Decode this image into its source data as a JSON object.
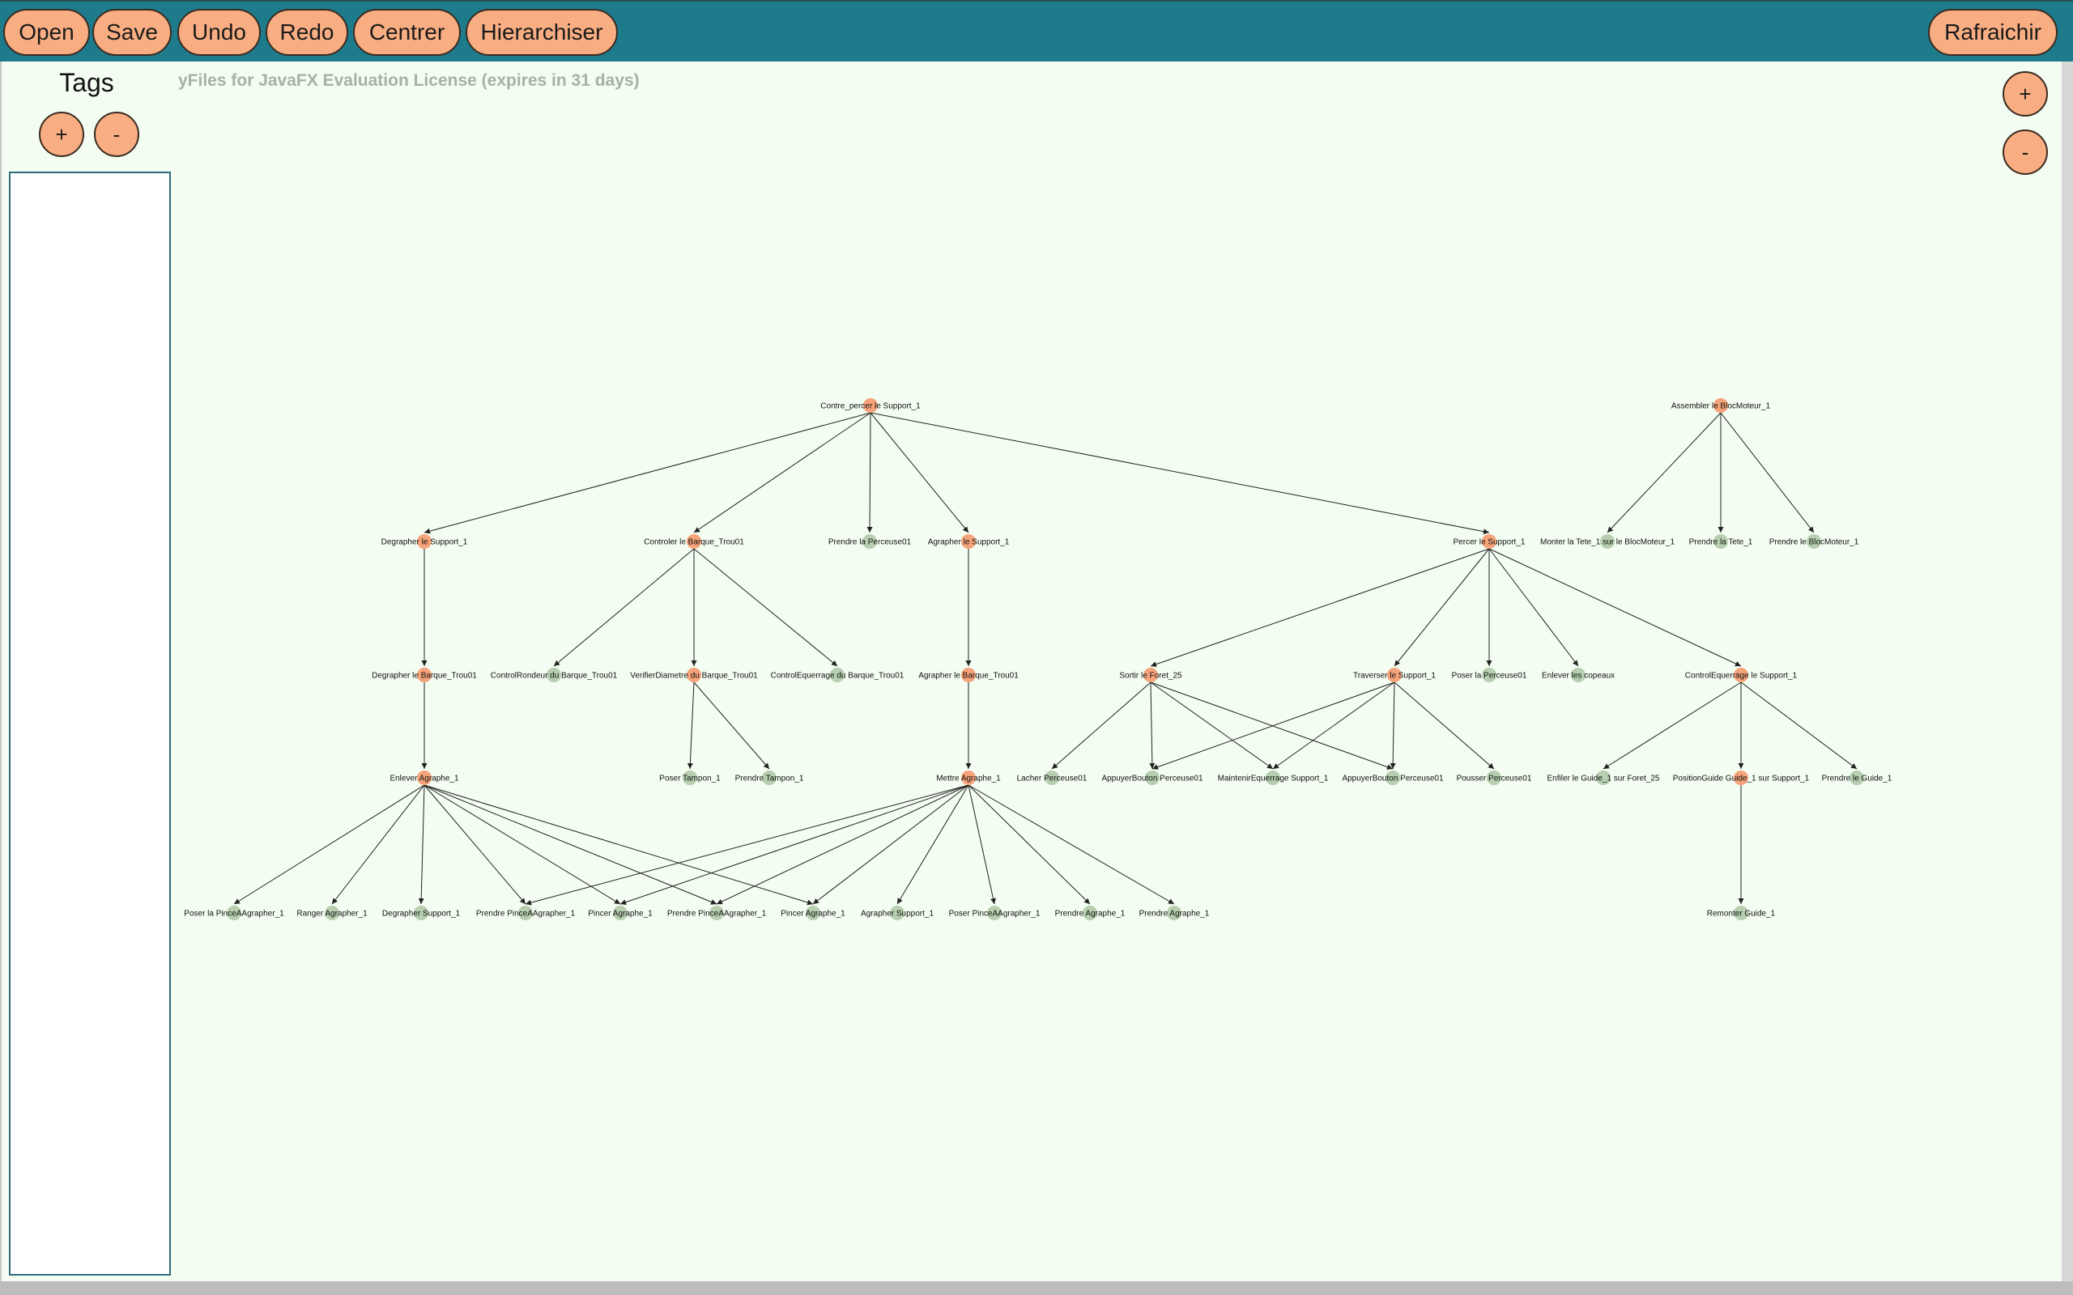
{
  "toolbar": {
    "open": "Open",
    "save": "Save",
    "undo": "Undo",
    "redo": "Redo",
    "centrer": "Centrer",
    "hierarchiser": "Hierarchiser",
    "rafraichir": "Rafraichir"
  },
  "tags": {
    "title": "Tags",
    "add": "+",
    "remove": "-"
  },
  "zoom": {
    "in": "+",
    "out": "-"
  },
  "license": "yFiles for JavaFX Evaluation License (expires in 31 days)",
  "colors": {
    "toolbar": "#1e7b8b",
    "button": "#f8ae82",
    "canvas": "#f3fdf1",
    "node_composite": "#f5a37a",
    "node_leaf": "#b7cfb0"
  },
  "graph": {
    "nodes": [
      {
        "id": "n1",
        "label": "Contre_percer le Support_1",
        "kind": "composite"
      },
      {
        "id": "n2",
        "label": "Assembler le BlocMoteur_1",
        "kind": "composite"
      },
      {
        "id": "n3",
        "label": "Degrapher le Support_1",
        "kind": "composite"
      },
      {
        "id": "n4",
        "label": "Controler le Barque_Trou01",
        "kind": "composite"
      },
      {
        "id": "n5",
        "label": "Prendre la Perceuse01",
        "kind": "leaf"
      },
      {
        "id": "n6",
        "label": "Agrapher le Support_1",
        "kind": "composite"
      },
      {
        "id": "n7",
        "label": "Percer le Support_1",
        "kind": "composite"
      },
      {
        "id": "n8",
        "label": "Monter la Tete_1 sur le BlocMoteur_1",
        "kind": "leaf"
      },
      {
        "id": "n9",
        "label": "Prendre la Tete_1",
        "kind": "leaf"
      },
      {
        "id": "n10",
        "label": "Prendre le BlocMoteur_1",
        "kind": "leaf"
      },
      {
        "id": "n11",
        "label": "Degrapher le Barque_Trou01",
        "kind": "composite"
      },
      {
        "id": "n12",
        "label": "ControlRondeur du Barque_Trou01",
        "kind": "leaf"
      },
      {
        "id": "n13",
        "label": "VerifierDiametre du Barque_Trou01",
        "kind": "composite"
      },
      {
        "id": "n14",
        "label": "ControlEquerrage du Barque_Trou01",
        "kind": "leaf"
      },
      {
        "id": "n15",
        "label": "Agrapher le Barque_Trou01",
        "kind": "composite"
      },
      {
        "id": "n16",
        "label": "Sortir le Foret_25",
        "kind": "composite"
      },
      {
        "id": "n17",
        "label": "Traverser le Support_1",
        "kind": "composite"
      },
      {
        "id": "n18",
        "label": "Poser la Perceuse01",
        "kind": "leaf"
      },
      {
        "id": "n19",
        "label": "Enlever les copeaux",
        "kind": "leaf"
      },
      {
        "id": "n20",
        "label": "ControlEquerrage le Support_1",
        "kind": "composite"
      },
      {
        "id": "n21",
        "label": "Enlever Agraphe_1",
        "kind": "composite"
      },
      {
        "id": "n22",
        "label": "Poser Tampon_1",
        "kind": "leaf"
      },
      {
        "id": "n23",
        "label": "Prendre Tampon_1",
        "kind": "leaf"
      },
      {
        "id": "n24",
        "label": "Mettre Agraphe_1",
        "kind": "composite"
      },
      {
        "id": "n25",
        "label": "Lacher Perceuse01",
        "kind": "leaf"
      },
      {
        "id": "n26",
        "label": "AppuyerBouton Perceuse01",
        "kind": "leaf"
      },
      {
        "id": "n27",
        "label": "MaintenirEquerrage Support_1",
        "kind": "leaf"
      },
      {
        "id": "n28",
        "label": "AppuyerBouton Perceuse01",
        "kind": "leaf"
      },
      {
        "id": "n29",
        "label": "Pousser Perceuse01",
        "kind": "leaf"
      },
      {
        "id": "n30",
        "label": "Enfiler le Guide_1 sur Foret_25",
        "kind": "leaf"
      },
      {
        "id": "n31",
        "label": "PositionGuide Guide_1 sur Support_1",
        "kind": "composite"
      },
      {
        "id": "n32",
        "label": "Prendre le Guide_1",
        "kind": "leaf"
      },
      {
        "id": "n33",
        "label": "Poser la PinceAAgrapher_1",
        "kind": "leaf"
      },
      {
        "id": "n34",
        "label": "Ranger Agrapher_1",
        "kind": "leaf"
      },
      {
        "id": "n35",
        "label": "Degrapher Support_1",
        "kind": "leaf"
      },
      {
        "id": "n36",
        "label": "Prendre PinceAAgrapher_1",
        "kind": "leaf"
      },
      {
        "id": "n37",
        "label": "Pincer Agraphe_1",
        "kind": "leaf"
      },
      {
        "id": "n38",
        "label": "Prendre PinceAAgrapher_1",
        "kind": "leaf"
      },
      {
        "id": "n39",
        "label": "Pincer Agraphe_1",
        "kind": "leaf"
      },
      {
        "id": "n40",
        "label": "Agrapher Support_1",
        "kind": "leaf"
      },
      {
        "id": "n41",
        "label": "Poser PinceAAgrapher_1",
        "kind": "leaf"
      },
      {
        "id": "n42",
        "label": "Prendre Agraphe_1",
        "kind": "leaf"
      },
      {
        "id": "n43",
        "label": "Prendre Agraphe_1",
        "kind": "leaf"
      },
      {
        "id": "n44",
        "label": "Remonter Guide_1",
        "kind": "leaf"
      }
    ],
    "edges": [
      [
        "n1",
        "n3"
      ],
      [
        "n1",
        "n4"
      ],
      [
        "n1",
        "n5"
      ],
      [
        "n1",
        "n6"
      ],
      [
        "n1",
        "n7"
      ],
      [
        "n2",
        "n8"
      ],
      [
        "n2",
        "n9"
      ],
      [
        "n2",
        "n10"
      ],
      [
        "n3",
        "n11"
      ],
      [
        "n4",
        "n12"
      ],
      [
        "n4",
        "n13"
      ],
      [
        "n4",
        "n14"
      ],
      [
        "n6",
        "n15"
      ],
      [
        "n7",
        "n16"
      ],
      [
        "n7",
        "n17"
      ],
      [
        "n7",
        "n18"
      ],
      [
        "n7",
        "n19"
      ],
      [
        "n7",
        "n20"
      ],
      [
        "n11",
        "n21"
      ],
      [
        "n13",
        "n22"
      ],
      [
        "n13",
        "n23"
      ],
      [
        "n15",
        "n24"
      ],
      [
        "n16",
        "n25"
      ],
      [
        "n16",
        "n26"
      ],
      [
        "n16",
        "n27"
      ],
      [
        "n16",
        "n28"
      ],
      [
        "n17",
        "n26"
      ],
      [
        "n17",
        "n27"
      ],
      [
        "n17",
        "n28"
      ],
      [
        "n17",
        "n29"
      ],
      [
        "n20",
        "n30"
      ],
      [
        "n20",
        "n31"
      ],
      [
        "n20",
        "n32"
      ],
      [
        "n31",
        "n44"
      ],
      [
        "n21",
        "n33"
      ],
      [
        "n21",
        "n34"
      ],
      [
        "n21",
        "n35"
      ],
      [
        "n21",
        "n36"
      ],
      [
        "n21",
        "n37"
      ],
      [
        "n21",
        "n38"
      ],
      [
        "n21",
        "n39"
      ],
      [
        "n24",
        "n36"
      ],
      [
        "n24",
        "n37"
      ],
      [
        "n24",
        "n38"
      ],
      [
        "n24",
        "n39"
      ],
      [
        "n24",
        "n40"
      ],
      [
        "n24",
        "n41"
      ],
      [
        "n24",
        "n42"
      ],
      [
        "n24",
        "n43"
      ]
    ]
  }
}
